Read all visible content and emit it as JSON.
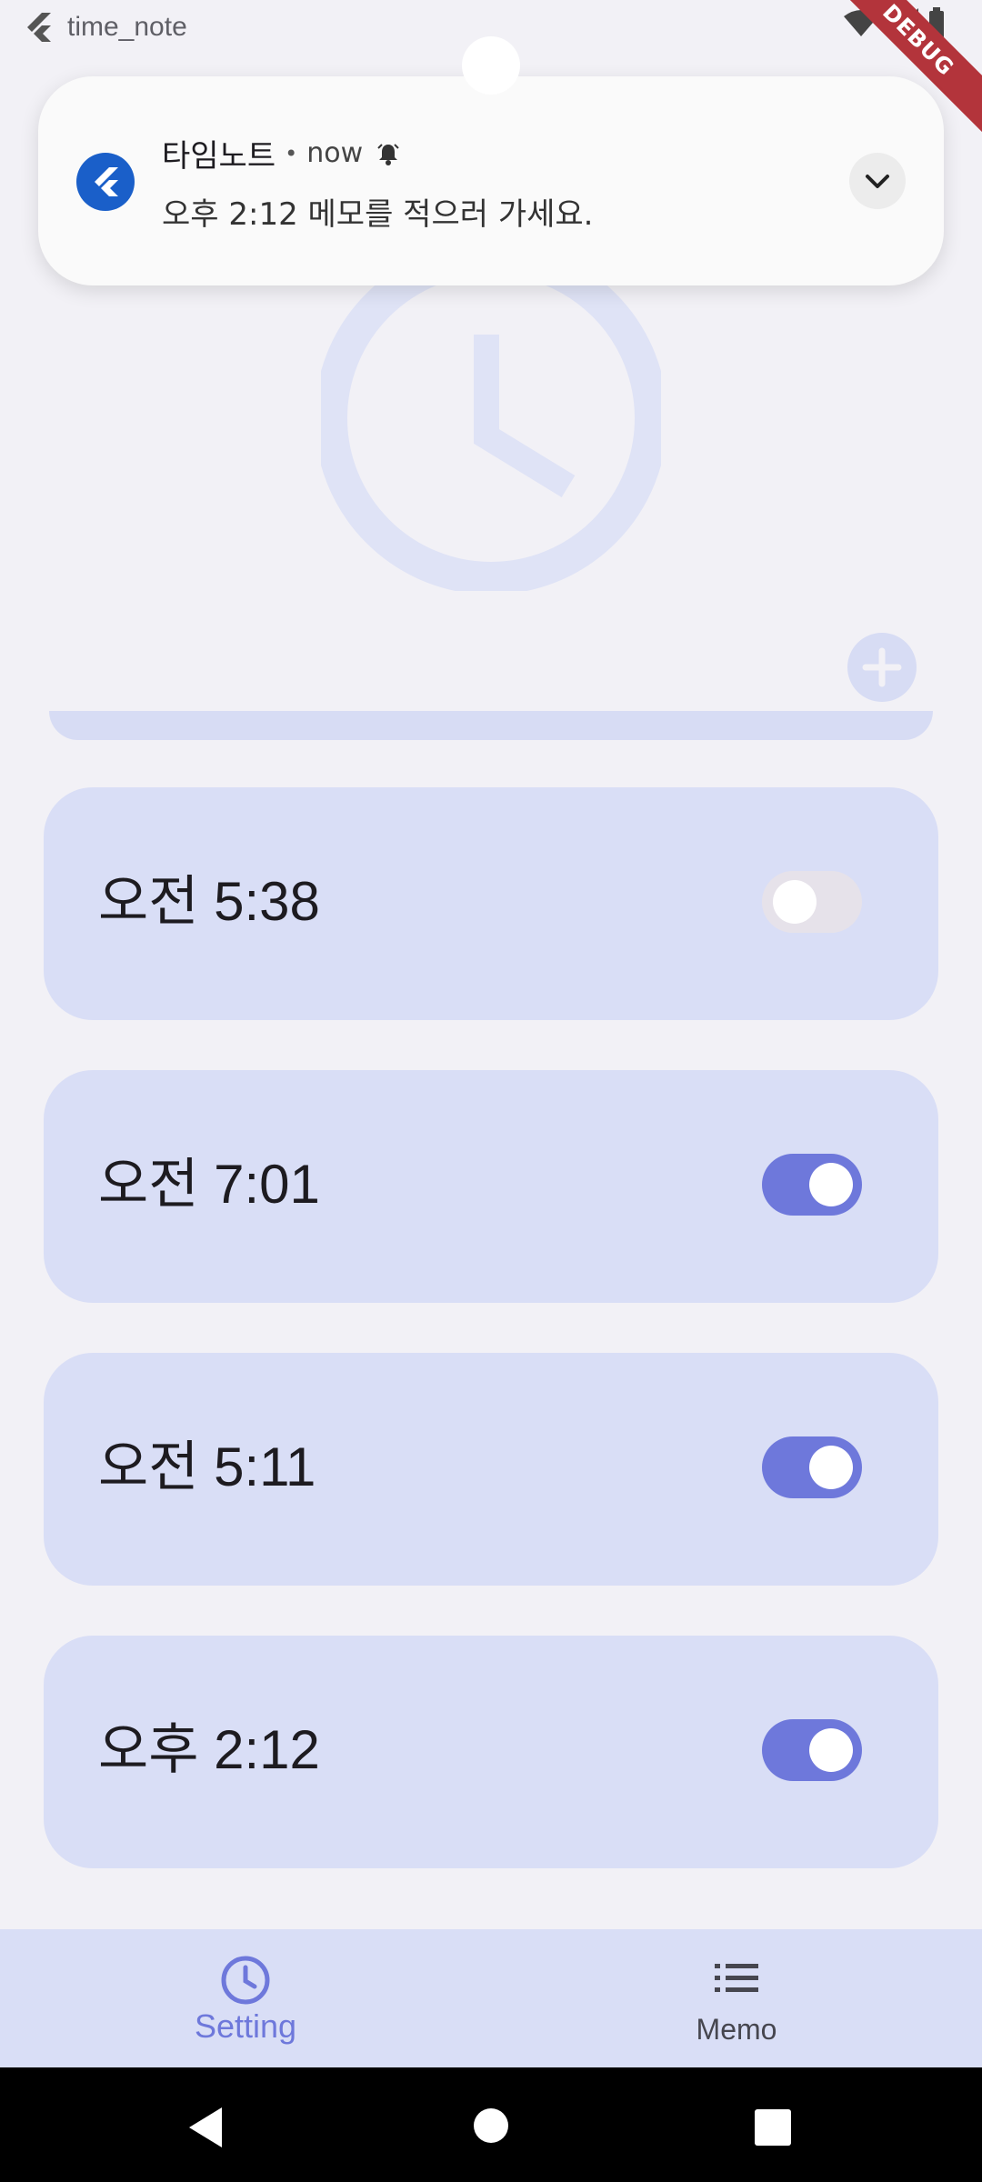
{
  "status_bar": {
    "app_title": "time_note",
    "debug_label": "DEBUG"
  },
  "notification": {
    "app_name": "타임노트",
    "separator": "•",
    "time": "now",
    "message": "오후 2:12 메모를 적으러 가세요."
  },
  "alarms": [
    {
      "time": "오전 5:38",
      "enabled": false
    },
    {
      "time": "오전 7:01",
      "enabled": true
    },
    {
      "time": "오전 5:11",
      "enabled": true
    },
    {
      "time": "오후 2:12",
      "enabled": true
    }
  ],
  "bottom_nav": {
    "setting_label": "Setting",
    "memo_label": "Memo",
    "active": "Setting"
  },
  "colors": {
    "accent": "#6e78db",
    "card": "#d9def6",
    "background": "#f2f1f6",
    "toggle_off": "#e6e2ea"
  }
}
